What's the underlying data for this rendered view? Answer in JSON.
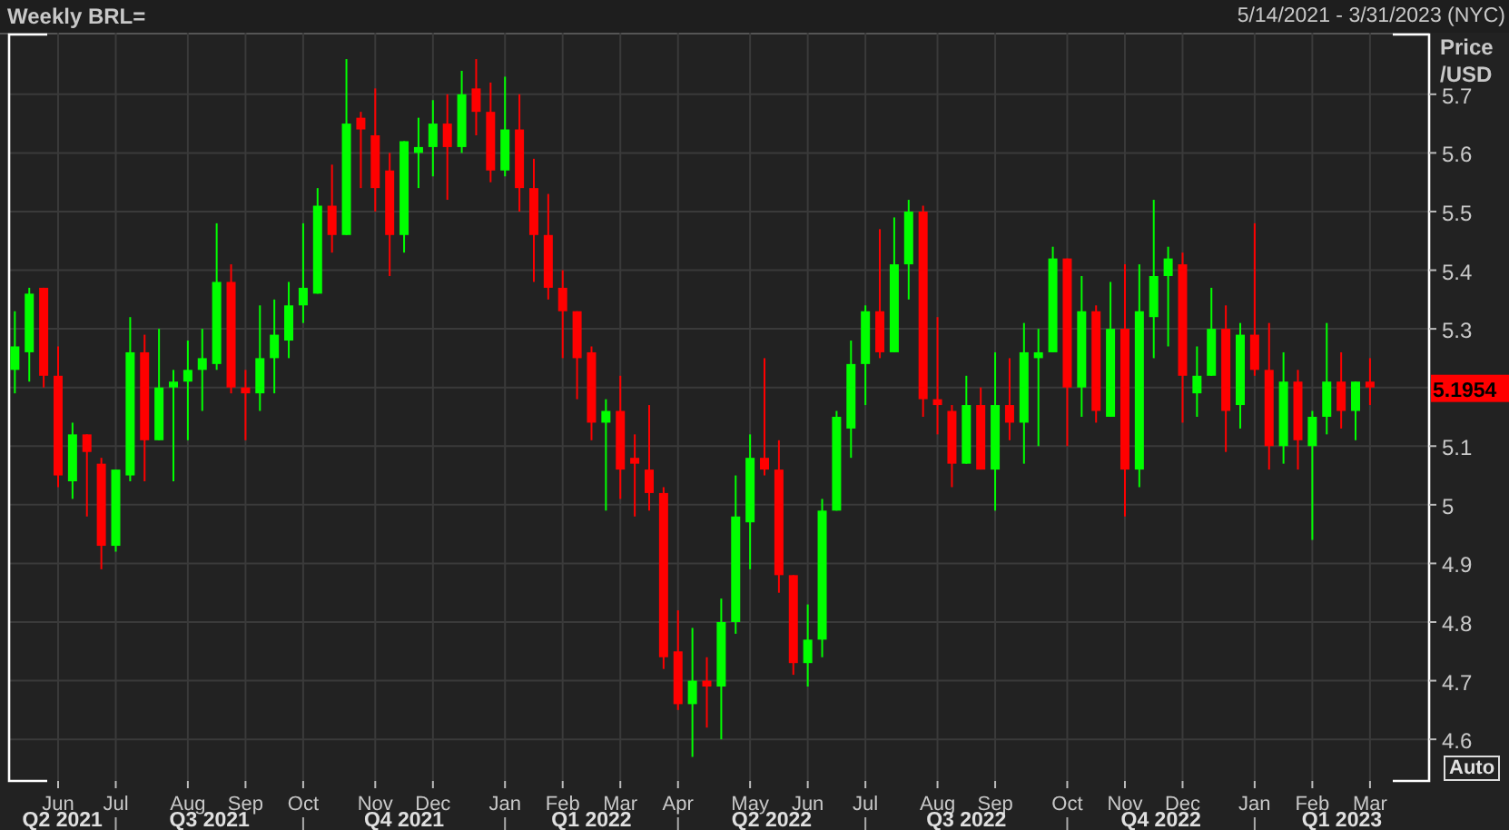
{
  "header": {
    "date_range": "5/14/2021 - 3/31/2023 (NYC)"
  },
  "chart": {
    "chart_data": {
      "type": "candlestick",
      "title": "Weekly BRL=",
      "ylabel": "Price /USD",
      "grid": true,
      "ylim": [
        4.529,
        5.805
      ],
      "yticks": [
        4.6,
        4.7,
        4.8,
        4.9,
        5,
        5.1,
        5.3,
        5.4,
        5.5,
        5.6,
        5.7
      ],
      "categories": [
        null,
        null,
        null,
        "Jun",
        null,
        null,
        null,
        "Jul",
        null,
        null,
        null,
        null,
        "Aug",
        null,
        null,
        null,
        "Sep",
        null,
        null,
        null,
        "Oct",
        null,
        null,
        null,
        null,
        "Nov",
        null,
        null,
        null,
        "Dec",
        null,
        null,
        null,
        null,
        "Jan",
        null,
        null,
        null,
        "Feb",
        null,
        null,
        null,
        "Mar",
        null,
        null,
        null,
        "Apr",
        null,
        null,
        null,
        null,
        "May",
        null,
        null,
        null,
        "Jun",
        null,
        null,
        null,
        "Jul",
        null,
        null,
        null,
        null,
        "Aug",
        null,
        null,
        null,
        "Sep",
        null,
        null,
        null,
        null,
        "Oct",
        null,
        null,
        null,
        "Nov",
        null,
        null,
        null,
        "Dec",
        null,
        null,
        null,
        null,
        "Jan",
        null,
        null,
        null,
        "Feb",
        null,
        null,
        null,
        "Mar"
      ],
      "ohlc": [
        [
          5.23,
          5.33,
          5.19,
          5.27
        ],
        [
          5.26,
          5.37,
          5.21,
          5.36
        ],
        [
          5.37,
          5.37,
          5.2,
          5.22
        ],
        [
          5.22,
          5.27,
          5.03,
          5.05
        ],
        [
          5.04,
          5.14,
          5.01,
          5.12
        ],
        [
          5.12,
          5.12,
          4.98,
          5.09
        ],
        [
          5.07,
          5.08,
          4.89,
          4.93
        ],
        [
          4.93,
          5.06,
          4.92,
          5.06
        ],
        [
          5.05,
          5.32,
          5.04,
          5.26
        ],
        [
          5.26,
          5.29,
          5.04,
          5.11
        ],
        [
          5.11,
          5.3,
          5.11,
          5.2
        ],
        [
          5.2,
          5.23,
          5.04,
          5.21
        ],
        [
          5.21,
          5.28,
          5.11,
          5.23
        ],
        [
          5.23,
          5.3,
          5.16,
          5.25
        ],
        [
          5.24,
          5.48,
          5.23,
          5.38
        ],
        [
          5.38,
          5.41,
          5.19,
          5.2
        ],
        [
          5.2,
          5.23,
          5.11,
          5.19
        ],
        [
          5.19,
          5.34,
          5.16,
          5.25
        ],
        [
          5.25,
          5.35,
          5.19,
          5.29
        ],
        [
          5.28,
          5.38,
          5.25,
          5.34
        ],
        [
          5.34,
          5.48,
          5.31,
          5.37
        ],
        [
          5.36,
          5.54,
          5.36,
          5.51
        ],
        [
          5.51,
          5.58,
          5.43,
          5.46
        ],
        [
          5.46,
          5.76,
          5.46,
          5.65
        ],
        [
          5.66,
          5.67,
          5.54,
          5.64
        ],
        [
          5.63,
          5.71,
          5.5,
          5.54
        ],
        [
          5.57,
          5.6,
          5.39,
          5.46
        ],
        [
          5.46,
          5.62,
          5.43,
          5.62
        ],
        [
          5.6,
          5.66,
          5.54,
          5.61
        ],
        [
          5.61,
          5.69,
          5.56,
          5.65
        ],
        [
          5.65,
          5.7,
          5.52,
          5.61
        ],
        [
          5.61,
          5.74,
          5.6,
          5.7
        ],
        [
          5.71,
          5.76,
          5.63,
          5.67
        ],
        [
          5.67,
          5.72,
          5.55,
          5.57
        ],
        [
          5.57,
          5.73,
          5.56,
          5.64
        ],
        [
          5.64,
          5.7,
          5.5,
          5.54
        ],
        [
          5.54,
          5.59,
          5.38,
          5.46
        ],
        [
          5.46,
          5.53,
          5.35,
          5.37
        ],
        [
          5.37,
          5.4,
          5.25,
          5.33
        ],
        [
          5.33,
          5.33,
          5.18,
          5.25
        ],
        [
          5.26,
          5.27,
          5.11,
          5.14
        ],
        [
          5.14,
          5.18,
          4.99,
          5.16
        ],
        [
          5.16,
          5.22,
          5.01,
          5.06
        ],
        [
          5.08,
          5.12,
          4.98,
          5.07
        ],
        [
          5.06,
          5.17,
          4.99,
          5.02
        ],
        [
          5.02,
          5.03,
          4.72,
          4.74
        ],
        [
          4.75,
          4.82,
          4.65,
          4.66
        ],
        [
          4.66,
          4.79,
          4.57,
          4.7
        ],
        [
          4.7,
          4.74,
          4.62,
          4.69
        ],
        [
          4.69,
          4.84,
          4.6,
          4.8
        ],
        [
          4.8,
          5.05,
          4.78,
          4.98
        ],
        [
          4.97,
          5.12,
          4.89,
          5.08
        ],
        [
          5.08,
          5.25,
          5.05,
          5.06
        ],
        [
          5.06,
          5.11,
          4.85,
          4.88
        ],
        [
          4.88,
          4.88,
          4.71,
          4.73
        ],
        [
          4.73,
          4.83,
          4.69,
          4.77
        ],
        [
          4.77,
          5.01,
          4.74,
          4.99
        ],
        [
          4.99,
          5.16,
          4.99,
          5.15
        ],
        [
          5.13,
          5.28,
          5.08,
          5.24
        ],
        [
          5.24,
          5.34,
          5.17,
          5.33
        ],
        [
          5.33,
          5.47,
          5.25,
          5.26
        ],
        [
          5.26,
          5.49,
          5.26,
          5.41
        ],
        [
          5.41,
          5.52,
          5.35,
          5.5
        ],
        [
          5.5,
          5.51,
          5.15,
          5.18
        ],
        [
          5.18,
          5.32,
          5.12,
          5.17
        ],
        [
          5.16,
          5.17,
          5.03,
          5.07
        ],
        [
          5.07,
          5.22,
          5.07,
          5.17
        ],
        [
          5.17,
          5.2,
          5.06,
          5.06
        ],
        [
          5.06,
          5.26,
          4.99,
          5.17
        ],
        [
          5.17,
          5.25,
          5.11,
          5.14
        ],
        [
          5.14,
          5.31,
          5.07,
          5.26
        ],
        [
          5.25,
          5.3,
          5.1,
          5.26
        ],
        [
          5.26,
          5.44,
          5.26,
          5.42
        ],
        [
          5.42,
          5.42,
          5.1,
          5.2
        ],
        [
          5.2,
          5.39,
          5.15,
          5.33
        ],
        [
          5.33,
          5.34,
          5.14,
          5.16
        ],
        [
          5.15,
          5.38,
          5.15,
          5.3
        ],
        [
          5.3,
          5.41,
          4.98,
          5.06
        ],
        [
          5.06,
          5.41,
          5.03,
          5.33
        ],
        [
          5.32,
          5.52,
          5.25,
          5.39
        ],
        [
          5.39,
          5.44,
          5.27,
          5.42
        ],
        [
          5.41,
          5.43,
          5.14,
          5.22
        ],
        [
          5.19,
          5.27,
          5.15,
          5.22
        ],
        [
          5.22,
          5.37,
          5.22,
          5.3
        ],
        [
          5.3,
          5.34,
          5.09,
          5.16
        ],
        [
          5.17,
          5.31,
          5.13,
          5.29
        ],
        [
          5.29,
          5.48,
          5.22,
          5.23
        ],
        [
          5.23,
          5.31,
          5.06,
          5.1
        ],
        [
          5.1,
          5.26,
          5.07,
          5.21
        ],
        [
          5.21,
          5.23,
          5.06,
          5.11
        ],
        [
          5.1,
          5.16,
          4.94,
          5.15
        ],
        [
          5.15,
          5.31,
          5.12,
          5.21
        ],
        [
          5.21,
          5.26,
          5.13,
          5.16
        ],
        [
          5.16,
          5.21,
          5.11,
          5.21
        ],
        [
          5.21,
          5.25,
          5.17,
          5.2
        ]
      ],
      "annotations": [
        "5.1954"
      ]
    },
    "quarters": [
      {
        "label": "Q2 2021"
      },
      {
        "label": "Q3 2021"
      },
      {
        "label": "Q4 2021"
      },
      {
        "label": "Q1 2022"
      },
      {
        "label": "Q2 2022"
      },
      {
        "label": "Q3 2022"
      },
      {
        "label": "Q4 2022"
      },
      {
        "label": "Q1 2023"
      }
    ],
    "auto_button": {
      "label": "Auto"
    }
  }
}
